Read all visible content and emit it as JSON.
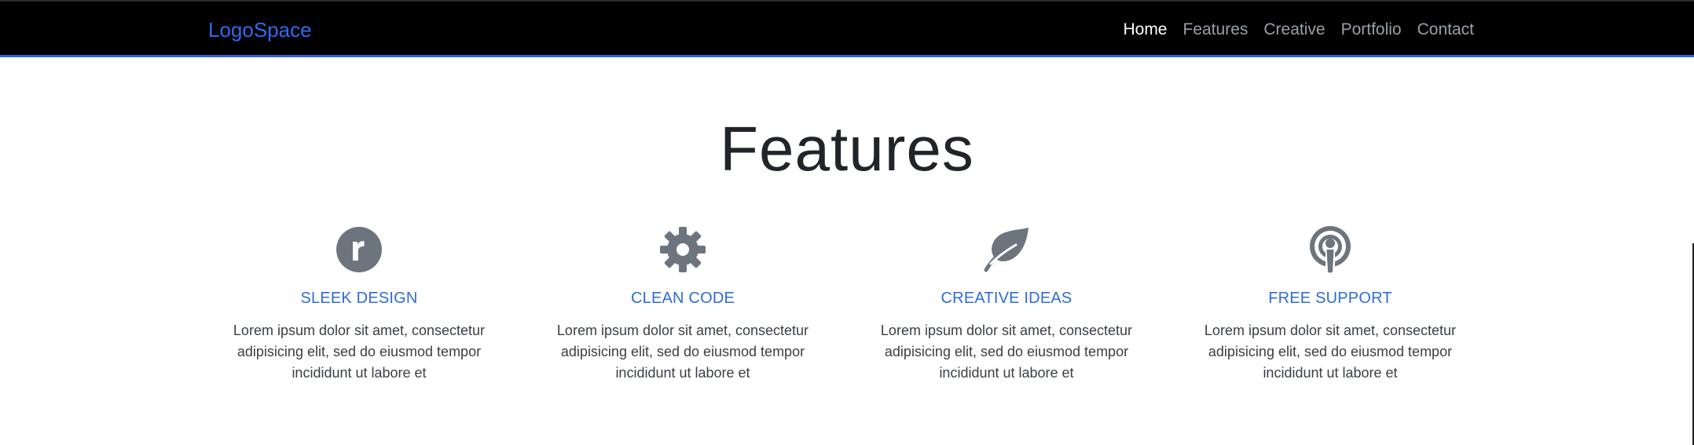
{
  "navbar": {
    "brand": "LogoSpace",
    "links": [
      {
        "label": "Home",
        "active": true
      },
      {
        "label": "Features",
        "active": false
      },
      {
        "label": "Creative",
        "active": false
      },
      {
        "label": "Portfolio",
        "active": false
      },
      {
        "label": "Contact",
        "active": false
      }
    ]
  },
  "features_section": {
    "title": "Features",
    "items": [
      {
        "icon": "r-circle-icon",
        "title": "SLEEK DESIGN",
        "description": "Lorem ipsum dolor sit amet, consectetur adipisicing elit, sed do eiusmod tempor incididunt ut labore et"
      },
      {
        "icon": "gear-icon",
        "title": "CLEAN CODE",
        "description": "Lorem ipsum dolor sit amet, consectetur adipisicing elit, sed do eiusmod tempor incididunt ut labore et"
      },
      {
        "icon": "leaf-icon",
        "title": "CREATIVE IDEAS",
        "description": "Lorem ipsum dolor sit amet, consectetur adipisicing elit, sed do eiusmod tempor incididunt ut labore et"
      },
      {
        "icon": "podcast-icon",
        "title": "FREE SUPPORT",
        "description": "Lorem ipsum dolor sit amet, consectetur adipisicing elit, sed do eiusmod tempor incididunt ut labore et"
      }
    ]
  },
  "colors": {
    "navbar_bg": "#000000",
    "brand": "#2f6bf0",
    "nav_underline": "#2f63d8",
    "feature_title": "#2f6bd8",
    "icon": "#6c757d"
  }
}
